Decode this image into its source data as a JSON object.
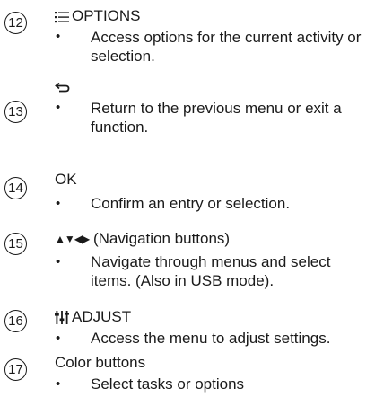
{
  "items": [
    {
      "number": "12",
      "heading": "OPTIONS",
      "icon": "list-icon",
      "description": "Access options for the current activity or selection."
    },
    {
      "number": "13",
      "heading": "",
      "icon": "back-arrow-icon",
      "description": "Return to the previous menu or exit a function."
    },
    {
      "number": "14",
      "heading": "OK",
      "icon": "",
      "description": "Confirm an entry or selection."
    },
    {
      "number": "15",
      "heading": "(Navigation buttons)",
      "icon": "arrows",
      "arrows": "▲▼◀▶",
      "description": "Navigate through menus and select items. (Also in USB mode)."
    },
    {
      "number": "16",
      "heading": "ADJUST",
      "icon": "adjust-sliders-icon",
      "description": "Access the menu to adjust settings."
    },
    {
      "number": "17",
      "heading": "Color buttons",
      "icon": "",
      "description": "Select tasks or options"
    }
  ],
  "bullet": "•"
}
